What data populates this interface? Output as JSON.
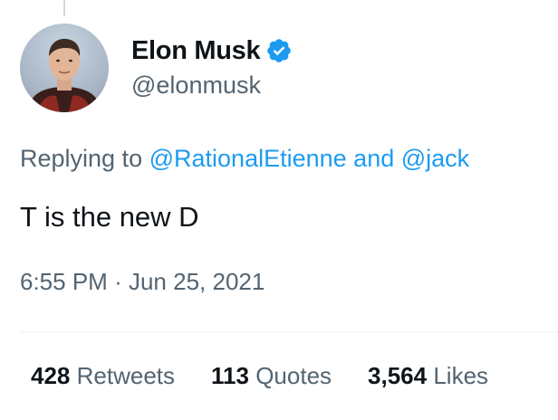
{
  "tweet": {
    "author": {
      "display_name": "Elon Musk",
      "handle": "@elonmusk",
      "verified": true
    },
    "reply_prefix": "Replying to",
    "reply_to": [
      "@RationalEtienne",
      "@jack"
    ],
    "reply_joiner": "and",
    "text": "T is the new D",
    "time": "6:55 PM",
    "separator": "·",
    "date": "Jun 25, 2021"
  },
  "stats": {
    "retweets": {
      "count": "428",
      "label": "Retweets"
    },
    "quotes": {
      "count": "113",
      "label": "Quotes"
    },
    "likes": {
      "count": "3,564",
      "label": "Likes"
    }
  },
  "colors": {
    "link": "#1d9bf0",
    "secondary_text": "#536471",
    "primary_text": "#0f1419",
    "verified_badge": "#1d9bf0"
  }
}
